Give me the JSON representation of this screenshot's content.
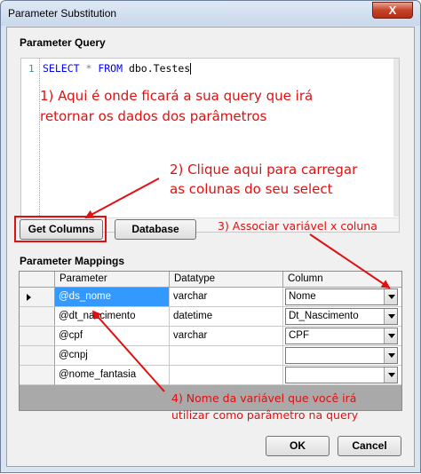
{
  "window": {
    "title": "Parameter Substitution",
    "close_label": "X"
  },
  "query": {
    "section_label": "Parameter Query",
    "line_number": "1",
    "code_select": "SELECT",
    "code_star": " * ",
    "code_from": "FROM",
    "code_table": " dbo.Testes"
  },
  "annotations": {
    "a1_line1": "1) Aqui é onde ficará a sua query que irá",
    "a1_line2": "retornar os dados dos parâmetros",
    "a2_line1": "2) Clique aqui para carregar",
    "a2_line2": "as colunas do seu select",
    "a3": "3) Associar variável x coluna",
    "a4_line1": "4) Nome da variável que você irá",
    "a4_line2": "utilizar como parâmetro na query"
  },
  "buttons": {
    "get_columns": "Get Columns",
    "database": "Database",
    "ok": "OK",
    "cancel": "Cancel"
  },
  "mappings": {
    "section_label": "Parameter Mappings",
    "headers": {
      "parameter": "Parameter",
      "datatype": "Datatype",
      "column": "Column"
    },
    "rows": [
      {
        "parameter": "@ds_nome",
        "datatype": "varchar",
        "column": "Nome"
      },
      {
        "parameter": "@dt_nascimento",
        "datatype": "datetime",
        "column": "Dt_Nascimento"
      },
      {
        "parameter": "@cpf",
        "datatype": "varchar",
        "column": "CPF"
      },
      {
        "parameter": "@cnpj",
        "datatype": "",
        "column": ""
      },
      {
        "parameter": "@nome_fantasia",
        "datatype": "",
        "column": ""
      }
    ]
  },
  "colors": {
    "annotation": "#e01010",
    "selection": "#3399ff"
  }
}
